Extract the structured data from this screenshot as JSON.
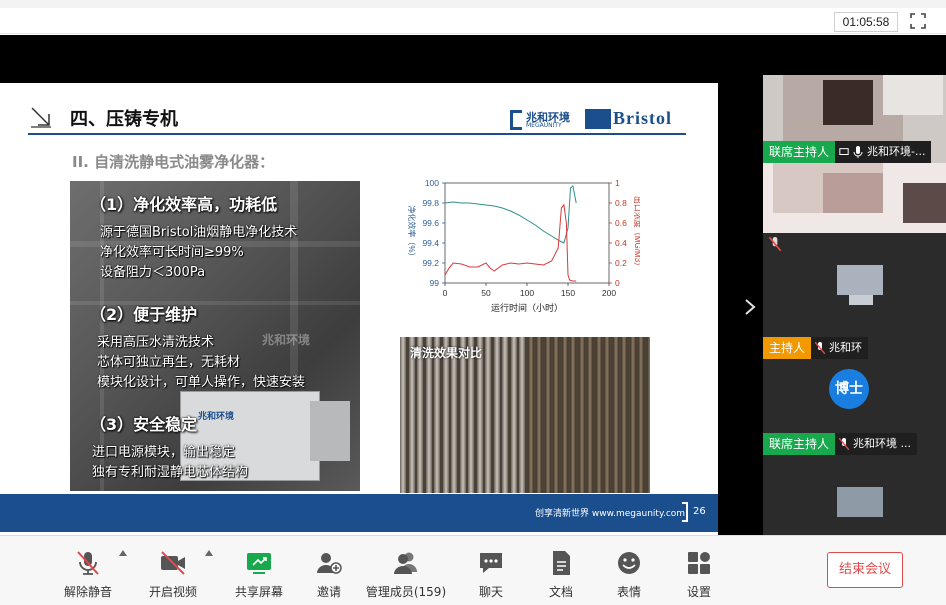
{
  "header": {
    "timer": "01:05:58",
    "fullscreen_icon": "fullscreen-icon"
  },
  "slide": {
    "title": "四、压铸专机",
    "logo_cn": "兆和环境",
    "logo_en": "MEGAUNITY",
    "bristol_logo": "Bristol",
    "subtitle": "II. 自清洗静电式油雾净化器：",
    "sections": [
      {
        "heading": "（1）净化效率高，功耗低",
        "lines": [
          "源于德国Bristol油烟静电净化技术",
          "净化效率可长时间≥99%",
          "设备阻力＜300Pa"
        ]
      },
      {
        "heading": "（2）便于维护",
        "lines": [
          "采用高压水清洗技术",
          "芯体可独立再生，无耗材",
          "模块化设计，可单人操作，快速安装"
        ]
      },
      {
        "heading": "（3）安全稳定",
        "lines": [
          "进口电源模块，输出稳定",
          "独有专利耐湿静电芯体结构"
        ]
      }
    ],
    "photo_watermark": "兆和环境",
    "comparison_label": "清洗效果对比",
    "footer_text": "创享清新世界 www.megaunity.com",
    "page_number": "26"
  },
  "chart_data": {
    "type": "line",
    "xlabel": "运行时间（小时）",
    "ylabel_left": "净化效率（%）",
    "ylabel_right": "出口浓度（MG/M3）",
    "x_ticks": [
      "0",
      "50",
      "100",
      "150",
      "200"
    ],
    "y_left_ticks": [
      "99",
      "99.2",
      "99.4",
      "99.6",
      "99.8",
      "100"
    ],
    "y_right_ticks": [
      "0",
      "0.2",
      "0.4",
      "0.6",
      "0.8",
      "1"
    ],
    "xlim": [
      0,
      200
    ],
    "ylim_left": [
      99,
      100
    ],
    "ylim_right": [
      0,
      1
    ],
    "grid": false,
    "series": [
      {
        "axis": "left",
        "color": "#2f8f8a",
        "x": [
          0,
          10,
          20,
          30,
          40,
          50,
          60,
          70,
          80,
          90,
          100,
          110,
          120,
          130,
          140,
          145,
          150,
          153,
          156,
          160
        ],
        "y": [
          99.8,
          99.81,
          99.8,
          99.8,
          99.79,
          99.78,
          99.77,
          99.75,
          99.72,
          99.68,
          99.63,
          99.58,
          99.52,
          99.47,
          99.42,
          99.4,
          99.55,
          99.95,
          99.97,
          99.8
        ]
      },
      {
        "axis": "right",
        "color": "#d93a3a",
        "x": [
          0,
          5,
          10,
          20,
          30,
          40,
          50,
          55,
          60,
          70,
          80,
          90,
          100,
          110,
          120,
          130,
          138,
          142,
          145,
          148,
          150,
          152,
          155,
          160
        ],
        "y": [
          0.08,
          0.15,
          0.2,
          0.19,
          0.16,
          0.16,
          0.2,
          0.15,
          0.12,
          0.18,
          0.2,
          0.19,
          0.2,
          0.19,
          0.18,
          0.22,
          0.35,
          0.75,
          0.78,
          0.6,
          0.08,
          0.03,
          0.02,
          0.02
        ]
      }
    ]
  },
  "video_panel": {
    "tiles": [
      {
        "role": "联席主持人",
        "role_color": "#18a84e",
        "name": "兆和环境-..."
      },
      {
        "role": "",
        "name": ""
      },
      {
        "role": "主持人",
        "role_color": "#f29900",
        "name": "兆和环"
      },
      {
        "role": "联席主持人",
        "role_color": "#18a84e",
        "name": "兆和环境 ...",
        "avatar_text": "博士"
      }
    ]
  },
  "toolbar": {
    "items": [
      {
        "label": "解除静音",
        "icon": "mic-muted-icon"
      },
      {
        "label": "开启视频",
        "icon": "camera-off-icon"
      },
      {
        "label": "共享屏幕",
        "icon": "share-screen-icon"
      },
      {
        "label": "邀请",
        "icon": "invite-user-icon"
      },
      {
        "label": "管理成员(159)",
        "icon": "members-icon"
      },
      {
        "label": "聊天",
        "icon": "chat-icon"
      },
      {
        "label": "文档",
        "icon": "document-icon"
      },
      {
        "label": "表情",
        "icon": "emoji-icon"
      },
      {
        "label": "设置",
        "icon": "settings-icon"
      }
    ],
    "end_meeting": "结束会议"
  }
}
